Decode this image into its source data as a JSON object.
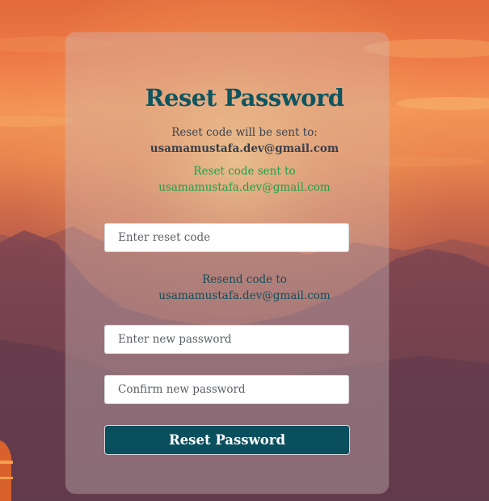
{
  "page": {
    "title": "Reset Password"
  },
  "reset_form": {
    "destination_label": "Reset code will be sent to:",
    "destination_email": "usamamustafa.dev@gmail.com",
    "sent_message_line1": "Reset code sent to",
    "sent_message_line2": "usamamustafa.dev@gmail.com",
    "reset_code_placeholder": "Enter reset code",
    "resend_line1": "Resend code to",
    "resend_line2": "usamamustafa.dev@gmail.com",
    "new_password_placeholder": "Enter new password",
    "confirm_password_placeholder": "Confirm new password",
    "submit_label": "Reset Password"
  },
  "colors": {
    "title": "#0d5560",
    "success": "#1aa34a",
    "link": "#0f4f5c",
    "button": "#0a4f5e"
  }
}
